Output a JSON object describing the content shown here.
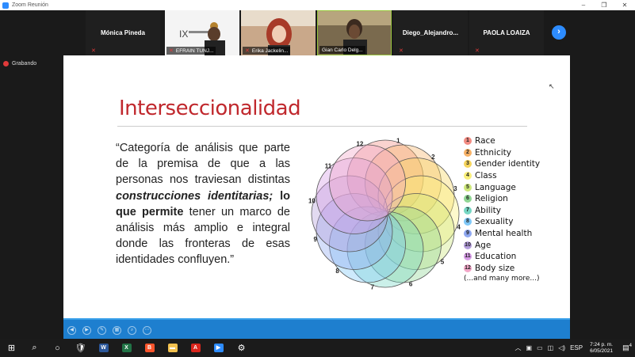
{
  "window": {
    "title": "Zoom Reunión",
    "controls": [
      "–",
      "❐",
      "✕"
    ]
  },
  "participants": [
    {
      "name": "Mónica Pineda",
      "type": "name-only",
      "muted": true
    },
    {
      "name": "EFRAIN TUNJ...",
      "type": "video",
      "video_text": "IX",
      "muted": true
    },
    {
      "name": "Erika Jackelin...",
      "type": "video",
      "muted": true
    },
    {
      "name": "Gian Carlo Delg...",
      "type": "video",
      "muted": false,
      "active_speaker": true
    },
    {
      "name": "Diego_Alejandro...",
      "type": "name-only",
      "muted": true
    },
    {
      "name": "PAOLA LOAIZA",
      "type": "name-only",
      "muted": true
    }
  ],
  "next_button": "›",
  "recording": {
    "label": "Grabando"
  },
  "slide": {
    "title": "Interseccionalidad",
    "quote_parts": {
      "p1": "“Categoría de análisis que parte de la premisa de que a las personas nos traviesan distintas ",
      "bold_italic": "construcciones identitarias;",
      "bold": " lo que permite",
      "p2": " tener un marco de análisis más amplio e integral donde las fronteras de esas identidades confluyen.”"
    },
    "wheel_numbers": [
      "1",
      "2",
      "3",
      "4",
      "5",
      "6",
      "7",
      "8",
      "9",
      "10",
      "11",
      "12"
    ],
    "legend": [
      {
        "num": "1",
        "label": "Race",
        "color": "#f28b82"
      },
      {
        "num": "2",
        "label": "Ethnicity",
        "color": "#f7b267"
      },
      {
        "num": "3",
        "label": "Gender identity",
        "color": "#f6d55c"
      },
      {
        "num": "4",
        "label": "Class",
        "color": "#f9ef7a"
      },
      {
        "num": "5",
        "label": "Language",
        "color": "#cde87a"
      },
      {
        "num": "6",
        "label": "Religion",
        "color": "#8fd694"
      },
      {
        "num": "7",
        "label": "Ability",
        "color": "#76d7c4"
      },
      {
        "num": "8",
        "label": "Sexuality",
        "color": "#7fc8f8"
      },
      {
        "num": "9",
        "label": "Mental health",
        "color": "#8fa8f0"
      },
      {
        "num": "10",
        "label": "Age",
        "color": "#b39ddb"
      },
      {
        "num": "11",
        "label": "Education",
        "color": "#d69be6"
      },
      {
        "num": "12",
        "label": "Body size",
        "color": "#f3a6c8"
      }
    ],
    "legend_more": "(...and many more...)"
  },
  "slide_controls": [
    "◀",
    "▶",
    "✎",
    "▦",
    "⌕",
    "⋯"
  ],
  "taskbar": {
    "apps": [
      {
        "name": "start",
        "glyph": "⊞"
      },
      {
        "name": "search",
        "glyph": "⌕"
      },
      {
        "name": "cortana",
        "glyph": "○"
      },
      {
        "name": "app-shield",
        "glyph": "🛡"
      },
      {
        "name": "word",
        "glyph": "W",
        "color": "#2b579a"
      },
      {
        "name": "excel",
        "glyph": "X",
        "color": "#217346"
      },
      {
        "name": "brave",
        "glyph": "B",
        "color": "#fb542b"
      },
      {
        "name": "explorer",
        "glyph": "▬",
        "color": "#f2c14e"
      },
      {
        "name": "acrobat",
        "glyph": "A",
        "color": "#d9251c"
      },
      {
        "name": "zoom",
        "glyph": "▶",
        "color": "#2d8cff"
      },
      {
        "name": "settings",
        "glyph": "⚙"
      }
    ],
    "tray": {
      "lang": "ESP",
      "time": "7:24 p. m.",
      "date": "6/05/2021",
      "notifications": "4"
    }
  }
}
